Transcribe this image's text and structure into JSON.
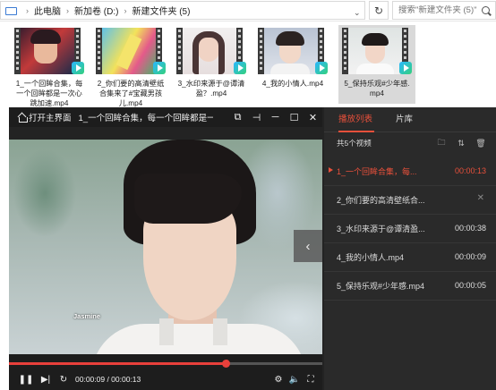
{
  "explorer": {
    "breadcrumb": [
      "此电脑",
      "新加卷 (D:)",
      "新建文件夹 (5)"
    ],
    "search_placeholder": "搜索\"新建文件夹 (5)\"",
    "files": [
      {
        "name_lines": [
          "1_一个回眸合集，每",
          "一个回眸都是一次心",
          "跳加速.mp4"
        ],
        "selected": false
      },
      {
        "name_lines": [
          "2_你们要的高清壁纸",
          "合集来了#宝藏男孩",
          "儿.mp4"
        ],
        "selected": false
      },
      {
        "name_lines": [
          "3_水印来源于@谭清",
          "盈？.mp4"
        ],
        "selected": false
      },
      {
        "name_lines": [
          "4_我的小情人.mp4"
        ],
        "selected": false
      },
      {
        "name_lines": [
          "5_保持乐观#少年感.",
          "mp4"
        ],
        "selected": true
      }
    ]
  },
  "player": {
    "home_label": "打开主界面",
    "title": "1_一个回眸合集，每一个回眸都是一次...",
    "watermark": "Jasmine",
    "current_time": "00:00:09",
    "total_time": "00:00:13",
    "progress_fraction": 0.692,
    "time_display": "00:00:09 / 00:00:13",
    "accent": "#e8403b"
  },
  "sidebar": {
    "tabs": [
      {
        "label": "播放列表",
        "active": true
      },
      {
        "label": "片库",
        "active": false
      }
    ],
    "count_label": "共5个视频",
    "items": [
      {
        "name": "1_一个回眸合集，每...",
        "duration": "00:00:13",
        "current": true
      },
      {
        "name": "2_你们要的高清壁纸合...",
        "duration": "",
        "current": false
      },
      {
        "name": "3_水印来源于@谭清盈...",
        "duration": "00:00:38",
        "current": false
      },
      {
        "name": "4_我的小情人.mp4",
        "duration": "00:00:09",
        "current": false
      },
      {
        "name": "5_保持乐观#少年感.mp4",
        "duration": "00:00:05",
        "current": false
      }
    ]
  }
}
